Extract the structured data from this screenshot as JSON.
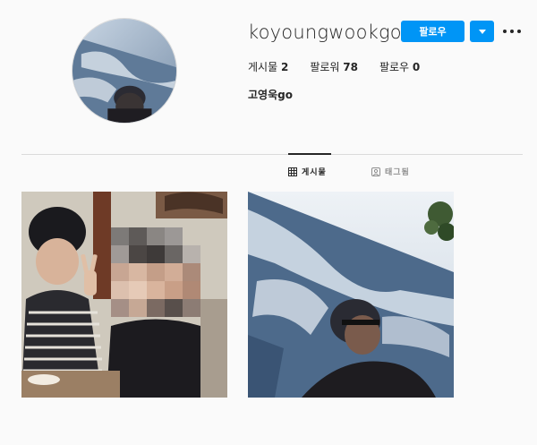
{
  "profile": {
    "username": "koyoungwookgo",
    "full_name": "고영욱go",
    "follow_label": "팔로우",
    "stats": {
      "posts_label": "게시물",
      "posts_count": "2",
      "followers_label": "팔로워",
      "followers_count": "78",
      "following_label": "팔로우",
      "following_count": "0"
    }
  },
  "tabs": {
    "posts_label": "게시물",
    "tagged_label": "태그됨"
  },
  "icons": {
    "grid": "grid-icon",
    "tagged": "tag-icon",
    "dropdown": "chevron-down-icon",
    "more": "more-options-icon"
  },
  "colors": {
    "accent": "#0095f6",
    "text": "#262626",
    "muted": "#8e8e8e",
    "background": "#fafafa",
    "divider": "#dbdbdb"
  }
}
